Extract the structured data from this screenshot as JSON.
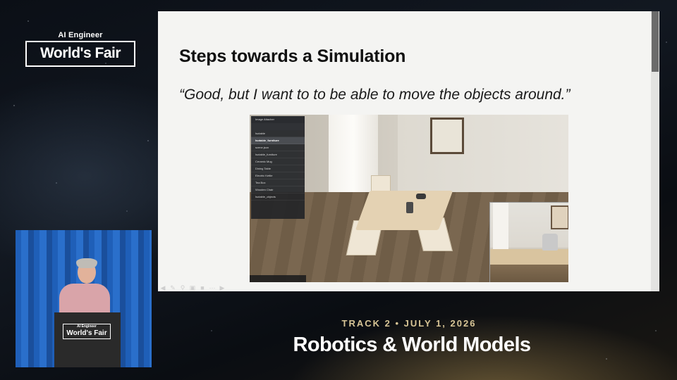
{
  "branding": {
    "small_line": "AI Engineer",
    "big_line": "World's Fair"
  },
  "slide": {
    "title": "Steps towards a Simulation",
    "quote": "“Good, but I want to to be able to move the objects around.”"
  },
  "sim_panel": {
    "header": "Image Attacher",
    "rows": [
      {
        "label": "Isotable",
        "selected": false
      },
      {
        "label": "Isotable_furniture",
        "selected": true
      },
      {
        "label": "scene.json",
        "selected": false
      },
      {
        "label": "Isotable_furniture",
        "selected": false
      },
      {
        "label": "Ceramic Mug",
        "selected": false
      },
      {
        "label": "Dining Table",
        "selected": false
      },
      {
        "label": "Electric Kettle",
        "selected": false
      },
      {
        "label": "Tea Box",
        "selected": false
      },
      {
        "label": "Wooden Chair",
        "selected": false
      },
      {
        "label": "Isotable_objects",
        "selected": false
      }
    ]
  },
  "podium": {
    "small_line": "AI Engineer",
    "big_line": "World's Fair"
  },
  "event": {
    "track_line": "TRACK 2 • JULY 1, 2026",
    "talk_title": "Robotics & World Models"
  },
  "icons": {
    "toolbar": [
      "back-arrow-icon",
      "pen-icon",
      "zoom-icon",
      "captions-icon",
      "camera-icon",
      "more-icon",
      "forward-arrow-icon"
    ]
  },
  "colors": {
    "accent_gold": "#d8c596",
    "backdrop_blue": "#1f5fb8"
  }
}
